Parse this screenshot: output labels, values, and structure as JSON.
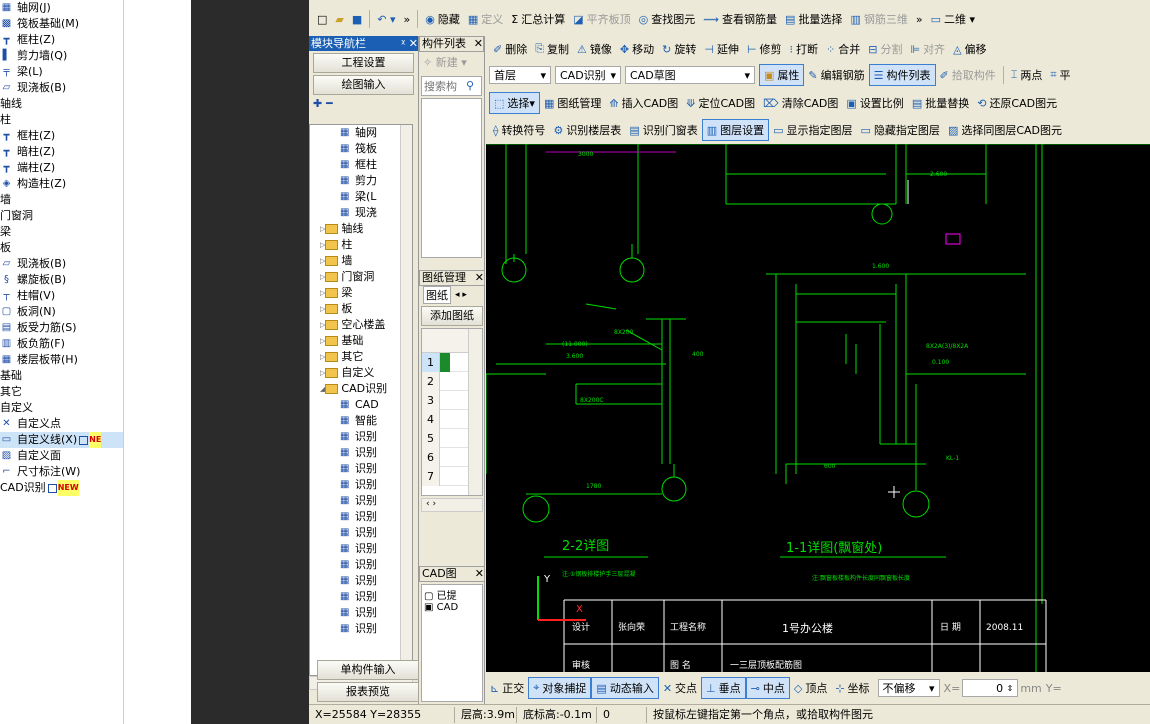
{
  "left_list": [
    {
      "icon": "axis-grid-icon",
      "label": "轴网(J)"
    },
    {
      "icon": "raft-foundation-icon",
      "label": "筏板基础(M)"
    },
    {
      "icon": "frame-column-icon",
      "label": "框柱(Z)"
    },
    {
      "icon": "shear-wall-icon",
      "label": "剪力墙(Q)"
    },
    {
      "icon": "beam-icon",
      "label": "梁(L)"
    },
    {
      "icon": "cast-slab-icon",
      "label": "现浇板(B)"
    },
    {
      "icon": "",
      "label": "轴线"
    },
    {
      "icon": "",
      "label": "柱"
    },
    {
      "icon": "frame-column-icon",
      "label": "框柱(Z)"
    },
    {
      "icon": "hidden-column-icon",
      "label": "暗柱(Z)"
    },
    {
      "icon": "end-column-icon",
      "label": "端柱(Z)"
    },
    {
      "icon": "structural-column-icon",
      "label": "构造柱(Z)"
    },
    {
      "icon": "",
      "label": "墙"
    },
    {
      "icon": "",
      "label": "门窗洞"
    },
    {
      "icon": "",
      "label": "梁"
    },
    {
      "icon": "",
      "label": "板"
    },
    {
      "icon": "cast-slab-icon",
      "label": "现浇板(B)"
    },
    {
      "icon": "spiral-slab-icon",
      "label": "螺旋板(B)"
    },
    {
      "icon": "column-cap-icon",
      "label": "柱帽(V)"
    },
    {
      "icon": "slab-hole-icon",
      "label": "板洞(N)"
    },
    {
      "icon": "slab-rebar-icon",
      "label": "板受力筋(S)"
    },
    {
      "icon": "slab-neg-rebar-icon",
      "label": "板负筋(F)"
    },
    {
      "icon": "floor-band-icon",
      "label": "楼层板带(H)"
    },
    {
      "icon": "",
      "label": "基础"
    },
    {
      "icon": "",
      "label": "其它"
    },
    {
      "icon": "",
      "label": "自定义"
    },
    {
      "icon": "custom-point-icon",
      "label": "自定义点"
    },
    {
      "icon": "custom-line-icon",
      "label": "自定义线(X)",
      "badge": "NE"
    },
    {
      "icon": "custom-area-icon",
      "label": "自定义面"
    },
    {
      "icon": "dimension-icon",
      "label": "尺寸标注(W)"
    },
    {
      "icon": "",
      "label": "CAD识别",
      "badge": "NEW"
    }
  ],
  "toolbar1": [
    "隐藏",
    "定义",
    "汇总计算",
    "平齐板顶",
    "查找图元",
    "查看钢筋量",
    "批量选择",
    "钢筋三维",
    "二维"
  ],
  "toolbar2": [
    "删除",
    "复制",
    "镜像",
    "移动",
    "旋转",
    "延伸",
    "修剪",
    "打断",
    "合并",
    "分割",
    "对齐",
    "偏移"
  ],
  "toolbar3": {
    "floor": "首层",
    "combo1": "CAD识别",
    "combo2": "CAD草图",
    "buttons": [
      "属性",
      "编辑钢筋",
      "构件列表",
      "拾取构件",
      "两点",
      "平"
    ]
  },
  "toolbar4": [
    "选择",
    "图纸管理",
    "插入CAD图",
    "定位CAD图",
    "清除CAD图",
    "设置比例",
    "批量替换",
    "还原CAD图元"
  ],
  "toolbar5": [
    "转换符号",
    "识别楼层表",
    "识别门窗表",
    "图层设置",
    "显示指定图层",
    "隐藏指定图层",
    "选择同图层CAD图元"
  ],
  "nav": {
    "title": "模块导航栏",
    "btn_project": "工程设置",
    "btn_draw": "绘图输入",
    "tree": [
      {
        "indent": 3,
        "type": "icon",
        "label": "轴网"
      },
      {
        "indent": 3,
        "type": "icon",
        "label": "筏板"
      },
      {
        "indent": 3,
        "type": "icon",
        "label": "框柱"
      },
      {
        "indent": 3,
        "type": "icon",
        "label": "剪力"
      },
      {
        "indent": 3,
        "type": "icon",
        "label": "梁(L"
      },
      {
        "indent": 3,
        "type": "icon",
        "label": "现浇"
      },
      {
        "indent": 1,
        "type": "folder",
        "label": "轴线"
      },
      {
        "indent": 1,
        "type": "folder",
        "label": "柱"
      },
      {
        "indent": 1,
        "type": "folder",
        "label": "墙"
      },
      {
        "indent": 1,
        "type": "folder",
        "label": "门窗洞"
      },
      {
        "indent": 1,
        "type": "folder",
        "label": "梁"
      },
      {
        "indent": 1,
        "type": "folder",
        "label": "板"
      },
      {
        "indent": 1,
        "type": "folder",
        "label": "空心楼盖"
      },
      {
        "indent": 1,
        "type": "folder",
        "label": "基础"
      },
      {
        "indent": 1,
        "type": "folder",
        "label": "其它"
      },
      {
        "indent": 1,
        "type": "folder",
        "label": "自定义"
      },
      {
        "indent": 1,
        "type": "folder",
        "label": "CAD识别"
      },
      {
        "indent": 3,
        "type": "icon",
        "label": "CAD"
      },
      {
        "indent": 3,
        "type": "icon",
        "label": "智能"
      },
      {
        "indent": 3,
        "type": "icon",
        "label": "识别"
      },
      {
        "indent": 3,
        "type": "icon",
        "label": "识别"
      },
      {
        "indent": 3,
        "type": "icon",
        "label": "识别"
      },
      {
        "indent": 3,
        "type": "icon",
        "label": "识别"
      },
      {
        "indent": 3,
        "type": "icon",
        "label": "识别"
      },
      {
        "indent": 3,
        "type": "icon",
        "label": "识别"
      },
      {
        "indent": 3,
        "type": "icon",
        "label": "识别"
      },
      {
        "indent": 3,
        "type": "icon",
        "label": "识别"
      },
      {
        "indent": 3,
        "type": "icon",
        "label": "识别"
      },
      {
        "indent": 3,
        "type": "icon",
        "label": "识别"
      },
      {
        "indent": 3,
        "type": "icon",
        "label": "识别"
      },
      {
        "indent": 3,
        "type": "icon",
        "label": "识别"
      },
      {
        "indent": 3,
        "type": "icon",
        "label": "识别"
      }
    ],
    "btn_single": "单构件输入",
    "btn_report": "报表预览"
  },
  "complist": {
    "title": "构件列表",
    "new_btn": "新建",
    "search_placeholder": "搜索构",
    "drawing_title": "图纸管理",
    "drawing_tab": "图纸",
    "add_btn": "添加图纸",
    "rows": [
      "1",
      "2",
      "3",
      "4",
      "5",
      "6",
      "7"
    ],
    "cad_title": "CAD图",
    "cad_items": [
      "已提",
      "CAD"
    ]
  },
  "drawing": {
    "label_22": "2-2详图",
    "label_11": "1-1详图(飘窗处)",
    "note_22": "注:①钢板排楼护手三层混凝",
    "note_11": "注:飘窗板楼板构件长度同飘窗板长度",
    "title_block": {
      "design": "设计",
      "designer": "张向荣",
      "proj_label": "工程名称",
      "proj_name": "1号办公楼",
      "date_label": "日 期",
      "date": "2008.11",
      "check": "审核",
      "drawing_label": "图 名",
      "drawing_name": "一三层顶板配筋图"
    },
    "dims": [
      "3000",
      "1780",
      "600",
      "400",
      "1.600",
      "0.100",
      "(11.000)",
      "3.600",
      "8X200",
      "8X200C",
      "2.600",
      "1.100",
      "KL-1",
      "8X2A(3)/8X2A",
      "1780",
      "1780"
    ]
  },
  "snapbar": {
    "items": [
      "正交",
      "对象捕捉",
      "动态输入",
      "交点",
      "垂点",
      "中点",
      "顶点",
      "坐标"
    ],
    "offset_label": "不偏移",
    "x_label": "X=",
    "x_value": "0",
    "unit": "mm",
    "y_label": "Y="
  },
  "status": {
    "coords": "X=25584 Y=28355",
    "floor_h": "层高:3.9m",
    "base_h": "底标高:-0.1m",
    "zero": "0",
    "hint": "按鼠标左键指定第一个角点，或拾取构件图元"
  }
}
